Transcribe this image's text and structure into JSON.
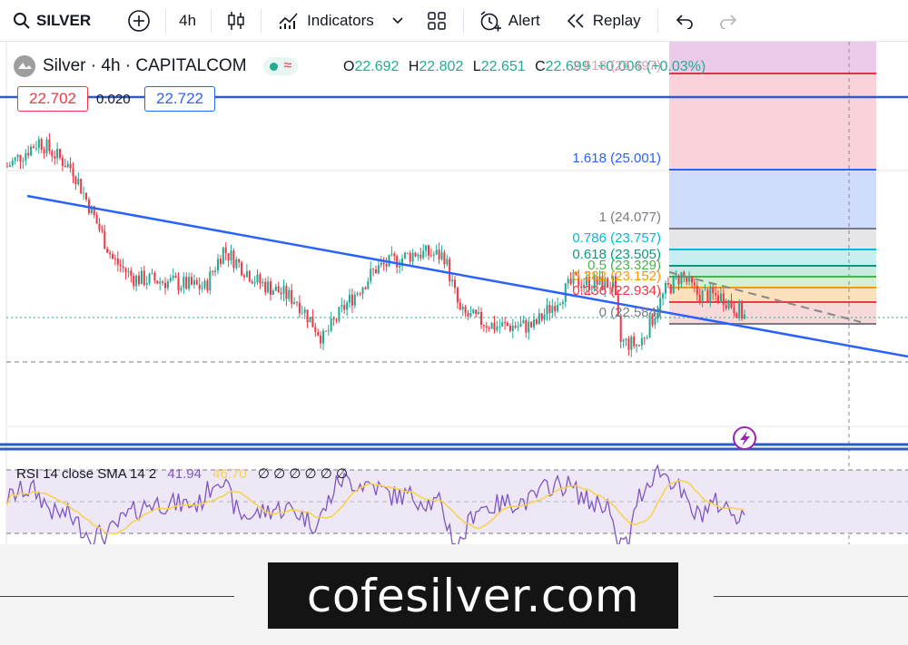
{
  "toolbar": {
    "symbol": "SILVER",
    "interval": "4h",
    "indicators_label": "Indicators",
    "alert_label": "Alert",
    "replay_label": "Replay"
  },
  "legend": {
    "title": "Silver · 4h · CAPITALCOM",
    "open_label": "O",
    "open": "22.692",
    "high_label": "H",
    "high": "22.802",
    "low_label": "L",
    "low": "22.651",
    "close_label": "C",
    "close": "22.699",
    "change": "+0.006 (+0.03%)",
    "sell_price": "22.702",
    "spread": "0.020",
    "buy_price": "22.722"
  },
  "fib_labels": [
    {
      "text": "2.618 (26.497)",
      "color": "#e0a0ae"
    },
    {
      "text": "1.618 (25.001)",
      "color": "#2962ff"
    },
    {
      "text": "1 (24.077)",
      "color": "#787b86"
    },
    {
      "text": "0.786 (23.757)",
      "color": "#00bcd4"
    },
    {
      "text": "0.618 (23.505)",
      "color": "#089981"
    },
    {
      "text": "0.5 (23.329)",
      "color": "#4caf50"
    },
    {
      "text": "0.382 (23.152)",
      "color": "#ff9800"
    },
    {
      "text": "0.236 (22.934)",
      "color": "#f23645"
    },
    {
      "text": "0 (22.584)",
      "color": "#787b86"
    }
  ],
  "rsi": {
    "label": "RSI 14 close SMA 14 2",
    "value": "41.94",
    "sma": "46.70",
    "extra": "∅ ∅ ∅ ∅ ∅ ∅"
  },
  "brand": {
    "text": "cofesilver.com"
  },
  "colors": {
    "up": "#22ab94",
    "down": "#f23645",
    "trendline": "#2962ff",
    "rsi_line": "#7e57c2",
    "rsi_sma": "#f7d24a",
    "rsi_band": "#ede7f6"
  },
  "chart_data": {
    "type": "candlestick",
    "symbol": "Silver",
    "timeframe": "4h",
    "exchange": "CAPITALCOM",
    "price_path": [
      {
        "bar": 0,
        "price": 25.05
      },
      {
        "bar": 12,
        "price": 25.45
      },
      {
        "bar": 25,
        "price": 25.0
      },
      {
        "bar": 40,
        "price": 23.6
      },
      {
        "bar": 48,
        "price": 23.3
      },
      {
        "bar": 60,
        "price": 23.25
      },
      {
        "bar": 75,
        "price": 23.15
      },
      {
        "bar": 82,
        "price": 23.75
      },
      {
        "bar": 95,
        "price": 23.25
      },
      {
        "bar": 110,
        "price": 22.95
      },
      {
        "bar": 120,
        "price": 22.35
      },
      {
        "bar": 128,
        "price": 22.85
      },
      {
        "bar": 140,
        "price": 23.45
      },
      {
        "bar": 155,
        "price": 23.7
      },
      {
        "bar": 166,
        "price": 23.65
      },
      {
        "bar": 172,
        "price": 22.75
      },
      {
        "bar": 185,
        "price": 22.55
      },
      {
        "bar": 200,
        "price": 22.55
      },
      {
        "bar": 215,
        "price": 23.25
      },
      {
        "bar": 230,
        "price": 23.2
      },
      {
        "bar": 233,
        "price": 22.3
      },
      {
        "bar": 240,
        "price": 22.25
      },
      {
        "bar": 250,
        "price": 23.1
      },
      {
        "bar": 256,
        "price": 23.35
      },
      {
        "bar": 262,
        "price": 23.05
      },
      {
        "bar": 272,
        "price": 23.0
      },
      {
        "bar": 280,
        "price": 22.7
      }
    ],
    "fib_retracement": [
      {
        "level": 2.618,
        "price": 26.497
      },
      {
        "level": 1.618,
        "price": 25.001
      },
      {
        "level": 1,
        "price": 24.077
      },
      {
        "level": 0.786,
        "price": 23.757
      },
      {
        "level": 0.618,
        "price": 23.505
      },
      {
        "level": 0.5,
        "price": 23.329
      },
      {
        "level": 0.382,
        "price": 23.152
      },
      {
        "level": 0.236,
        "price": 22.934
      },
      {
        "level": 0,
        "price": 22.584
      }
    ],
    "rsi": {
      "period": 14,
      "value": 41.94,
      "sma": 46.7
    }
  }
}
